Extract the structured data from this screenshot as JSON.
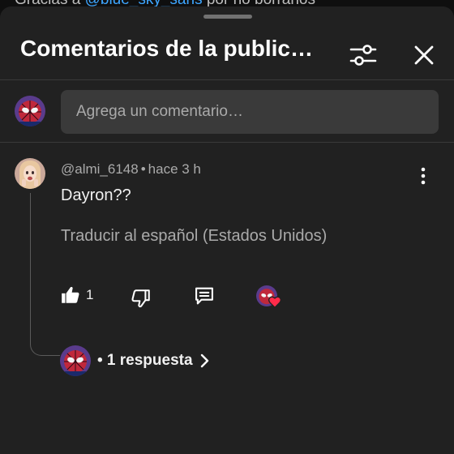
{
  "background_peek": {
    "text_before": "Gracias a ",
    "link": "@blue_sky_sans",
    "text_after": " por no borrarlos"
  },
  "header": {
    "title": "Comentarios de la public…",
    "filter_icon": "sliders-icon",
    "close_icon": "close-icon"
  },
  "composer": {
    "placeholder": "Agrega un comentario…"
  },
  "comment": {
    "author": "@almi_6148",
    "separator": "•",
    "time": "hace 3 h",
    "text": "Dayron??",
    "translate_label": "Traducir al español (Estados Unidos)",
    "like_count": "1"
  },
  "replies": {
    "label": "• 1 respuesta"
  },
  "colors": {
    "sheet": "#212121",
    "input": "#3a3a3a",
    "muted": "#aaaaaa",
    "link": "#3ea6ff",
    "heart": "#ff2b4a"
  }
}
